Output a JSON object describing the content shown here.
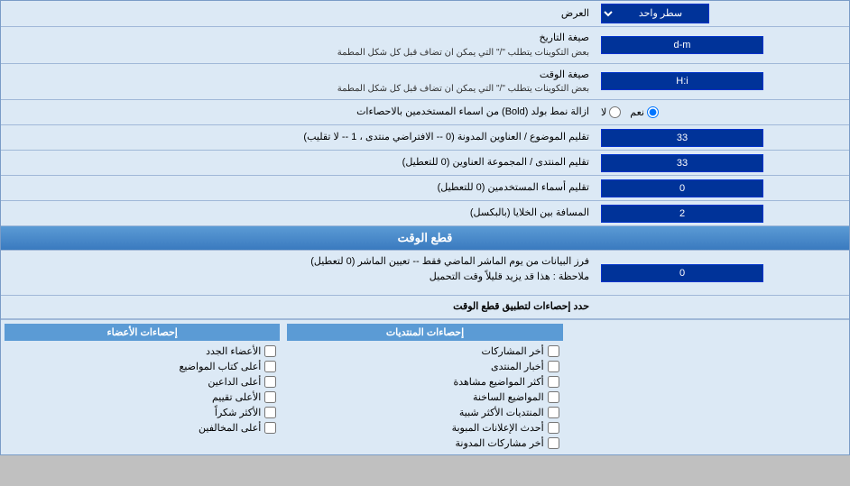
{
  "header": {
    "section_label": "العرض",
    "dropdown_label": "سطر واحد"
  },
  "rows": [
    {
      "id": "date_format",
      "label": "صيغة التاريخ",
      "sublabel": "بعض التكوينات يتطلب \"/\" التي يمكن ان تضاف قبل كل شكل المطمة",
      "input_value": "d-m",
      "input_type": "text"
    },
    {
      "id": "time_format",
      "label": "صيغة الوقت",
      "sublabel": "بعض التكوينات يتطلب \"/\" التي يمكن ان تضاف قبل كل شكل المطمة",
      "input_value": "H:i",
      "input_type": "text"
    },
    {
      "id": "bold_remove",
      "label": "ازالة نمط بولد (Bold) من اسماء المستخدمين بالاحصاءات",
      "input_type": "radio",
      "radio_options": [
        {
          "label": "نعم",
          "value": "yes",
          "checked": true
        },
        {
          "label": "لا",
          "value": "no",
          "checked": false
        }
      ]
    },
    {
      "id": "topics_order",
      "label": "تقليم الموضوع / العناوين المدونة (0 -- الافتراضي منتدى ، 1 -- لا تقليب)",
      "input_value": "33",
      "input_type": "text"
    },
    {
      "id": "forum_order",
      "label": "تقليم المنتدى / المجموعة العناوين (0 للتعطيل)",
      "input_value": "33",
      "input_type": "text"
    },
    {
      "id": "usernames_trim",
      "label": "تقليم أسماء المستخدمين (0 للتعطيل)",
      "input_value": "0",
      "input_type": "text"
    },
    {
      "id": "cell_spacing",
      "label": "المسافة بين الخلايا (بالبكسل)",
      "input_value": "2",
      "input_type": "text"
    }
  ],
  "time_cut_section": {
    "title": "قطع الوقت",
    "row": {
      "label": "فرز البيانات من يوم الماشر الماضي فقط -- تعيين الماشر (0 لتعطيل)",
      "sublabel": "ملاحظة : هذا قد يزيد قليلاً وقت التحميل",
      "input_value": "0"
    },
    "limit_label": "حدد إحصاءات لتطبيق قطع الوقت"
  },
  "stats_cols": {
    "posts_header": "إحصاءات المنتديات",
    "members_header": "إحصاءات الأعضاء",
    "posts_items": [
      "أخر المشاركات",
      "أخبار المنتدى",
      "أكثر المواضيع مشاهدة",
      "المواضيع الساخنة",
      "المنتديات الأكثر شبية",
      "أحدث الإعلانات المبوبة",
      "أخر مشاركات المدونة"
    ],
    "members_items": [
      "الأعضاء الجدد",
      "أعلى كتاب المواضيع",
      "أعلى الداعين",
      "الأعلى تقييم",
      "الأكثر شكراً",
      "أعلى المخالفين"
    ]
  }
}
